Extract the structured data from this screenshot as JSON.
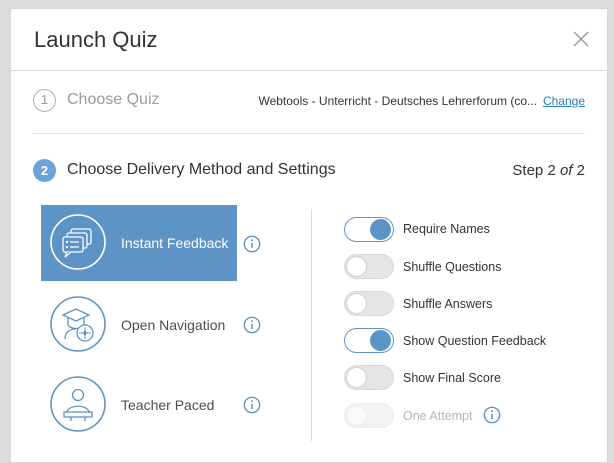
{
  "dialog": {
    "title": "Launch Quiz"
  },
  "step1": {
    "number": "1",
    "label": "Choose Quiz",
    "quiz_name": "Webtools - Unterricht - Deutsches Lehrerforum (co...",
    "change_label": "Change"
  },
  "step2": {
    "number": "2",
    "label": "Choose Delivery Method and Settings",
    "step_prefix": "Step 2 ",
    "step_of": "of",
    "step_total": " 2"
  },
  "methods": [
    {
      "label": "Instant Feedback",
      "selected": true
    },
    {
      "label": "Open Navigation",
      "selected": false
    },
    {
      "label": "Teacher Paced",
      "selected": false
    }
  ],
  "settings": [
    {
      "label": "Require Names",
      "state": "on"
    },
    {
      "label": "Shuffle Questions",
      "state": "off"
    },
    {
      "label": "Shuffle Answers",
      "state": "off"
    },
    {
      "label": "Show Question Feedback",
      "state": "on"
    },
    {
      "label": "Show Final Score",
      "state": "off"
    },
    {
      "label": "One Attempt",
      "state": "disabled"
    }
  ],
  "colors": {
    "accent": "#5e93c6",
    "link": "#2a7bb8"
  }
}
